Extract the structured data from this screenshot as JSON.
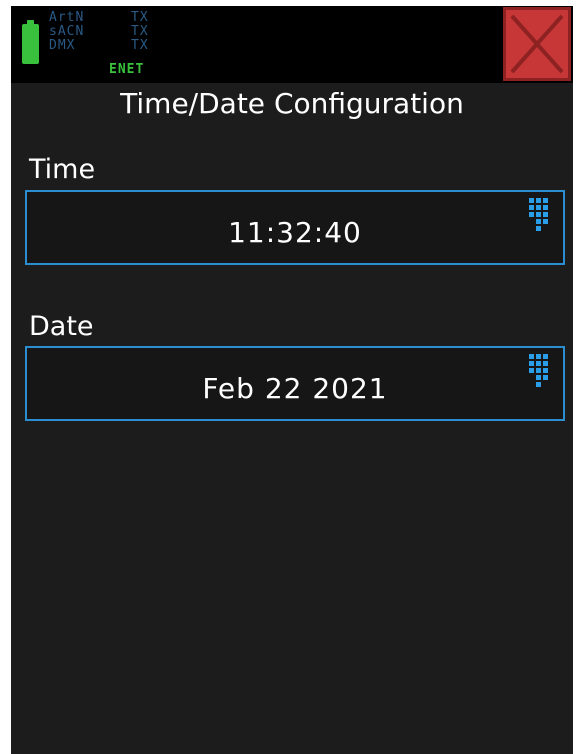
{
  "status": {
    "protocols": [
      {
        "name": "ArtN",
        "state": "TX"
      },
      {
        "name": "sACN",
        "state": "TX"
      },
      {
        "name": "DMX",
        "state": "TX"
      }
    ],
    "network": "ENET",
    "battery_color": "#39c03c"
  },
  "close_button": {
    "icon": "close-icon",
    "color": "#c73737"
  },
  "title": "Time/Date Configuration",
  "time": {
    "label": "Time",
    "value": "11:32:40",
    "icon": "keypad-icon"
  },
  "date": {
    "label": "Date",
    "value": "Feb 22 2021",
    "icon": "keypad-icon"
  },
  "accent_color": "#2a8ed0"
}
